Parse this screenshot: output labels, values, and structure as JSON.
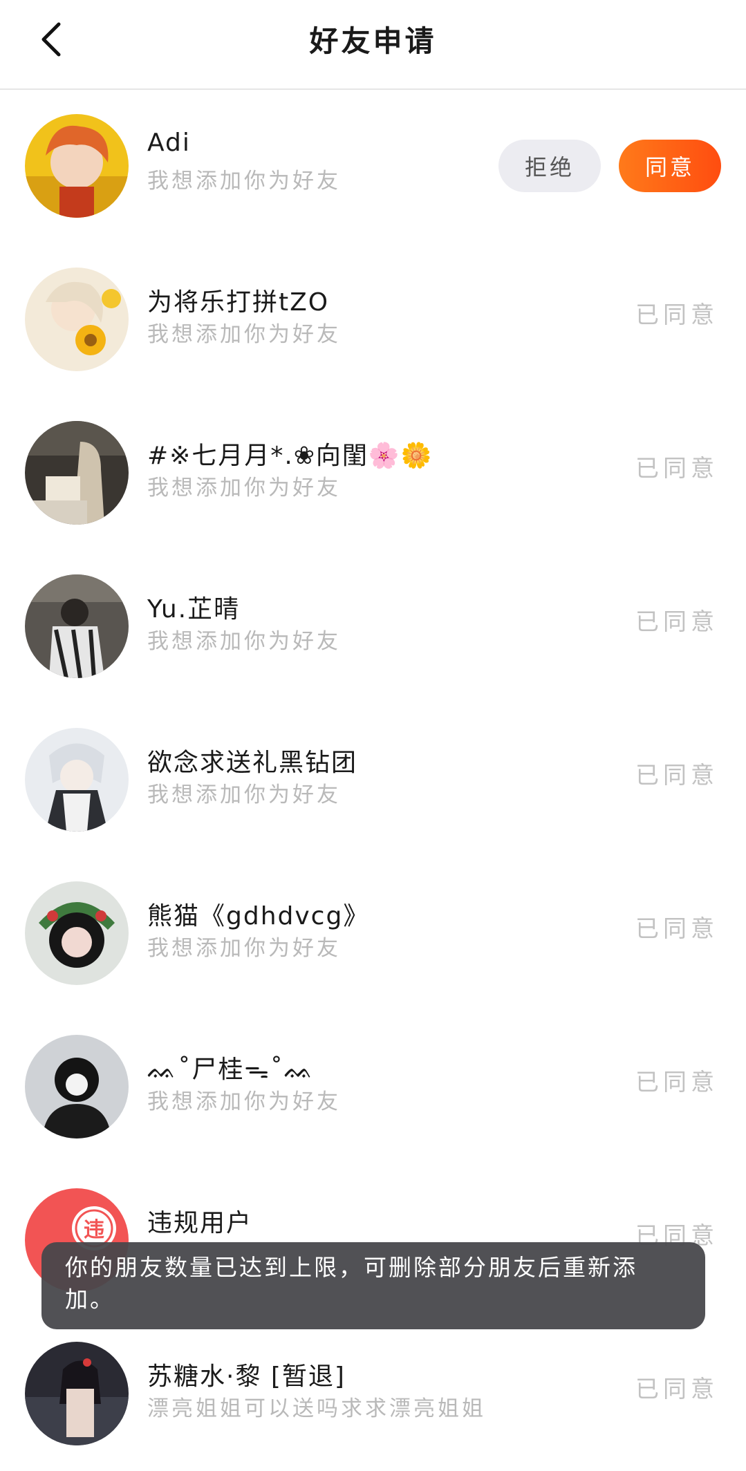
{
  "header": {
    "title": "好友申请"
  },
  "requests": [
    {
      "name": "Adi",
      "message": "我想添加你为好友",
      "status": "",
      "reject_label": "拒绝",
      "accept_label": "同意"
    },
    {
      "name": "为将乐打拼tZO",
      "message": "我想添加你为好友",
      "status": "已同意"
    },
    {
      "name": "#※七月月*.❀向閨🌸🌼",
      "message": "我想添加你为好友",
      "status": "已同意"
    },
    {
      "name": "Yu.芷晴",
      "message": "我想添加你为好友",
      "status": "已同意"
    },
    {
      "name": "欲念求送礼黑钻团",
      "message": "我想添加你为好友",
      "status": "已同意"
    },
    {
      "name": "熊猫《gdhdvcg》",
      "message": "我想添加你为好友",
      "status": "已同意"
    },
    {
      "name": "ᨐ˚尸桂ᯓ˚ᨐ",
      "message": "我想添加你为好友",
      "status": "已同意"
    },
    {
      "name": "违规用户",
      "message": "",
      "status": "已同意",
      "avatar_badge": "违"
    },
    {
      "name": "苏糖水·黎 [暂退]",
      "message": "漂亮姐姐可以送吗求求漂亮姐姐",
      "status": "已同意"
    }
  ],
  "toast": {
    "text": "你的朋友数量已达到上限，可删除部分朋友后重新添加。"
  },
  "colors": {
    "accent": "#ff5a14",
    "muted": "#b9b9b9",
    "toast_bg": "#46464a"
  }
}
